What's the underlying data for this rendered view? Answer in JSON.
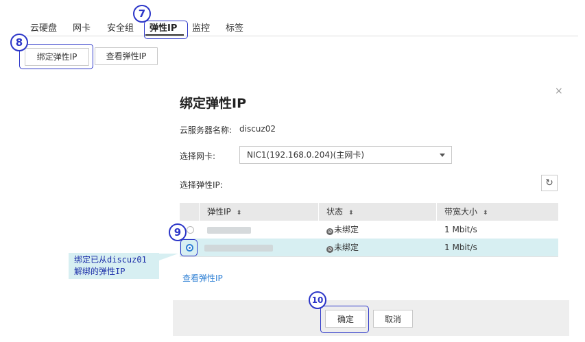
{
  "tabs": [
    {
      "label": "云硬盘"
    },
    {
      "label": "网卡"
    },
    {
      "label": "安全组"
    },
    {
      "label": "弹性IP"
    },
    {
      "label": "监控"
    },
    {
      "label": "标签"
    }
  ],
  "actions": {
    "bind_eip": "绑定弹性IP",
    "view_eip": "查看弹性IP"
  },
  "callouts": {
    "c7": "7",
    "c8": "8",
    "c9": "9",
    "c10": "10"
  },
  "dialog": {
    "title": "绑定弹性IP",
    "close": "×",
    "server_name_label": "云服务器名称:",
    "server_name_value": "discuz02",
    "nic_label": "选择网卡:",
    "nic_selected": "NIC1(192.168.0.204)(主网卡)",
    "eip_label": "选择弹性IP:",
    "table": {
      "headers": [
        "弹性IP",
        "状态",
        "带宽大小"
      ],
      "rows": [
        {
          "status": "未绑定",
          "bandwidth": "1 Mbit/s",
          "selected": false
        },
        {
          "status": "未绑定",
          "bandwidth": "1 Mbit/s",
          "selected": true
        }
      ]
    },
    "view_link": "查看弹性IP",
    "confirm": "确定",
    "cancel": "取消"
  },
  "note": {
    "line1": "绑定已从discuz01",
    "line2": "解绑的弹性IP"
  },
  "colors": {
    "callout": "#2b35c8",
    "selected_row": "#d7eff2",
    "link": "#2d7fd4"
  }
}
